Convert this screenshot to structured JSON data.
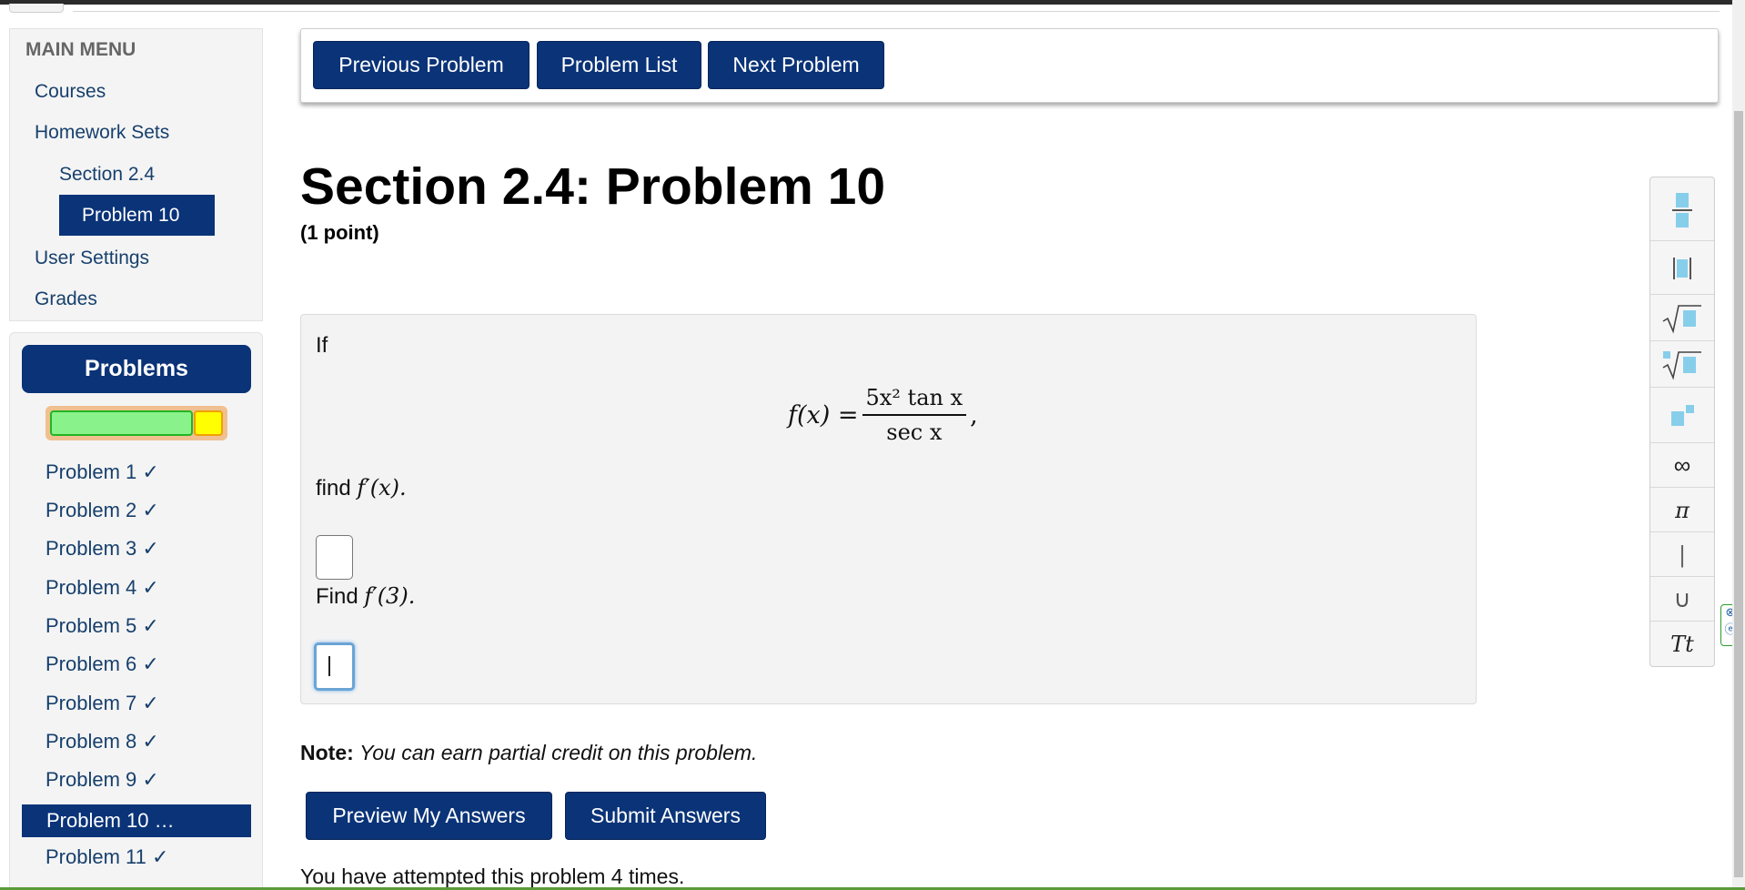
{
  "main_menu": {
    "title": "MAIN MENU",
    "items": [
      "Courses",
      "Homework Sets",
      "Section 2.4",
      "Problem 10",
      "User Settings",
      "Grades"
    ]
  },
  "problems_panel": {
    "title": "Problems",
    "progress_correct_fraction": 0.82,
    "items": [
      "Problem 1 ✓",
      "Problem 2 ✓",
      "Problem 3 ✓",
      "Problem 4 ✓",
      "Problem 5 ✓",
      "Problem 6 ✓",
      "Problem 7 ✓",
      "Problem 8 ✓",
      "Problem 9 ✓",
      "Problem 10 …",
      "Problem 11 ✓"
    ]
  },
  "nav": {
    "prev": "Previous Problem",
    "list": "Problem List",
    "next": "Next Problem"
  },
  "problem": {
    "title": "Section 2.4: Problem 10",
    "points": "(1 point)",
    "intro": "If",
    "eq_lhs": "f(x) =",
    "eq_num": "5x² tan x",
    "eq_den": "sec x",
    "eq_tail": ",",
    "q1_prefix": "find",
    "q1_math": "f′(x).",
    "q2_prefix": "Find",
    "q2_math": "f′(3)."
  },
  "note": {
    "label": "Note:",
    "text": "You can earn partial credit on this problem."
  },
  "actions": {
    "preview": "Preview My Answers",
    "submit": "Submit Answers"
  },
  "attempts_text": "You have attempted this problem 4 times.",
  "toolbar": {
    "icons": [
      "fraction-icon",
      "absolute-value-icon",
      "square-root-icon",
      "nth-root-icon",
      "exponent-icon",
      "infinity-icon",
      "pi-icon",
      "vertical-bar-icon",
      "union-icon",
      "text-mode-icon"
    ],
    "infinity": "∞",
    "pi": "π",
    "bar": "|",
    "union": "∪",
    "text_mode": "Tt"
  },
  "colors": {
    "primary": "#0a3378",
    "link": "#17406d",
    "progress_green": "#8af28a",
    "progress_yellow": "#ffff00"
  }
}
